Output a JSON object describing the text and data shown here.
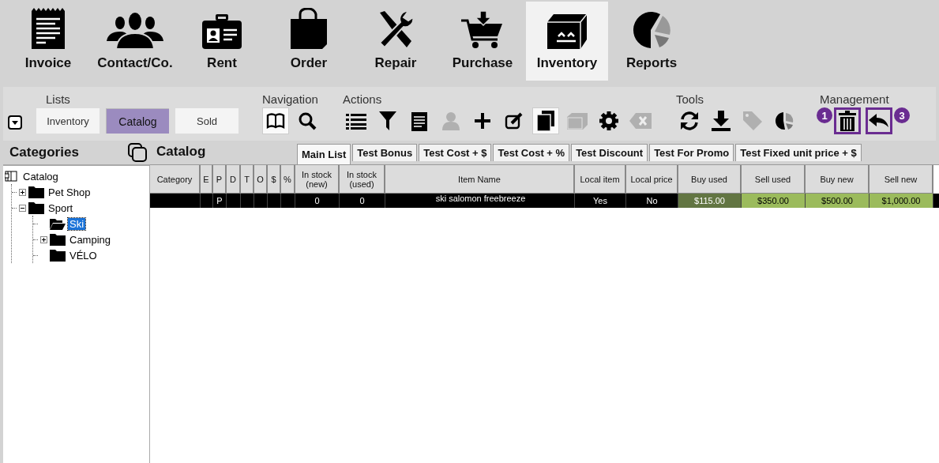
{
  "modules": [
    {
      "kind": "invoice",
      "label": "Invoice",
      "selected": false
    },
    {
      "kind": "contacts",
      "label": "Contact/Co.",
      "selected": false
    },
    {
      "kind": "badge",
      "label": "Rent",
      "selected": false
    },
    {
      "kind": "bag",
      "label": "Order",
      "selected": false
    },
    {
      "kind": "tools",
      "label": "Repair",
      "selected": false
    },
    {
      "kind": "cart",
      "label": "Purchase",
      "selected": false
    },
    {
      "kind": "box",
      "label": "Inventory",
      "selected": true
    },
    {
      "kind": "pie",
      "label": "Reports",
      "selected": false
    }
  ],
  "toolbar": {
    "groups": [
      {
        "title": "Lists",
        "kind": "lists",
        "buttons": [
          {
            "label": "Inventory",
            "selected": false
          },
          {
            "label": "Catalog",
            "selected": true
          },
          {
            "label": "Sold",
            "selected": false
          }
        ]
      },
      {
        "title": "Navigation",
        "kind": "icons",
        "icons": [
          {
            "kind": "book",
            "selected": true,
            "disabled": false
          },
          {
            "kind": "search",
            "selected": false,
            "disabled": false
          }
        ]
      },
      {
        "title": "Actions",
        "kind": "icons",
        "icons": [
          {
            "kind": "list",
            "selected": false,
            "disabled": false
          },
          {
            "kind": "filter",
            "selected": false,
            "disabled": false
          },
          {
            "kind": "notepad",
            "selected": false,
            "disabled": false
          },
          {
            "kind": "person",
            "selected": false,
            "disabled": true
          },
          {
            "kind": "plus",
            "selected": false,
            "disabled": false
          },
          {
            "kind": "edit",
            "selected": false,
            "disabled": false
          },
          {
            "kind": "copy",
            "selected": true,
            "disabled": false
          },
          {
            "kind": "box",
            "selected": false,
            "disabled": true
          },
          {
            "kind": "gear",
            "selected": false,
            "disabled": false
          },
          {
            "kind": "clear",
            "selected": false,
            "disabled": true
          }
        ]
      },
      {
        "title": "Tools",
        "kind": "icons",
        "icons": [
          {
            "kind": "refresh",
            "selected": false,
            "disabled": false
          },
          {
            "kind": "download",
            "selected": false,
            "disabled": false
          },
          {
            "kind": "tag",
            "selected": false,
            "disabled": true
          },
          {
            "kind": "pie",
            "selected": false,
            "disabled": false
          }
        ]
      },
      {
        "title": "Management",
        "kind": "icons",
        "icons": [
          {
            "kind": "trash",
            "selected": false,
            "disabled": false,
            "highlighted": true,
            "badge_before": "1"
          },
          {
            "kind": "back",
            "selected": false,
            "disabled": false,
            "highlighted": true,
            "badge_after": "3"
          }
        ]
      }
    ]
  },
  "categories": {
    "title": "Categories",
    "tree": [
      {
        "label": "Catalog",
        "kind": "root",
        "selected": false,
        "children": [
          {
            "label": "Pet Shop",
            "kind": "folder",
            "expanded": false,
            "has_children": true,
            "selected": false
          },
          {
            "label": "Sport",
            "kind": "folder",
            "expanded": true,
            "has_children": true,
            "selected": false,
            "children": [
              {
                "label": "Ski",
                "kind": "folder",
                "has_children": false,
                "selected": true
              },
              {
                "label": "Camping",
                "kind": "folder",
                "expanded": false,
                "has_children": true,
                "selected": false
              },
              {
                "label": "VÉLO",
                "kind": "folder",
                "has_children": false,
                "selected": false
              }
            ]
          }
        ]
      }
    ]
  },
  "catalog": {
    "title": "Catalog",
    "tabs": [
      {
        "label": "Main List",
        "selected": true
      },
      {
        "label": "Test Bonus",
        "selected": false
      },
      {
        "label": "Test Cost + $",
        "selected": false
      },
      {
        "label": "Test Cost + %",
        "selected": false
      },
      {
        "label": "Test Discount",
        "selected": false
      },
      {
        "label": "Test For Promo",
        "selected": false
      },
      {
        "label": "Test Fixed unit price + $",
        "selected": false
      }
    ],
    "table": {
      "columns": [
        "Category",
        "E",
        "P",
        "D",
        "T",
        "O",
        "$",
        "%",
        "In stock (new)",
        "In stock (used)",
        "Item Name",
        "Local item",
        "Local price",
        "Buy used",
        "Sell used",
        "Buy new",
        "Sell new"
      ],
      "rows": [
        {
          "selected": true,
          "cells": [
            {
              "text": ""
            },
            {
              "text": ""
            },
            {
              "text": "P"
            },
            {
              "text": ""
            },
            {
              "text": ""
            },
            {
              "text": ""
            },
            {
              "text": ""
            },
            {
              "text": ""
            },
            {
              "text": "0"
            },
            {
              "text": "0"
            },
            {
              "text": "ski salomon freebreeze"
            },
            {
              "text": "Yes"
            },
            {
              "text": "No"
            },
            {
              "text": "$115.00",
              "color": "#627542"
            },
            {
              "text": "$350.00",
              "color": "#9bbb5c"
            },
            {
              "text": "$500.00",
              "color": "#9bbb5c"
            },
            {
              "text": "$1,000.00",
              "color": "#9bbb5c"
            }
          ]
        }
      ]
    }
  }
}
